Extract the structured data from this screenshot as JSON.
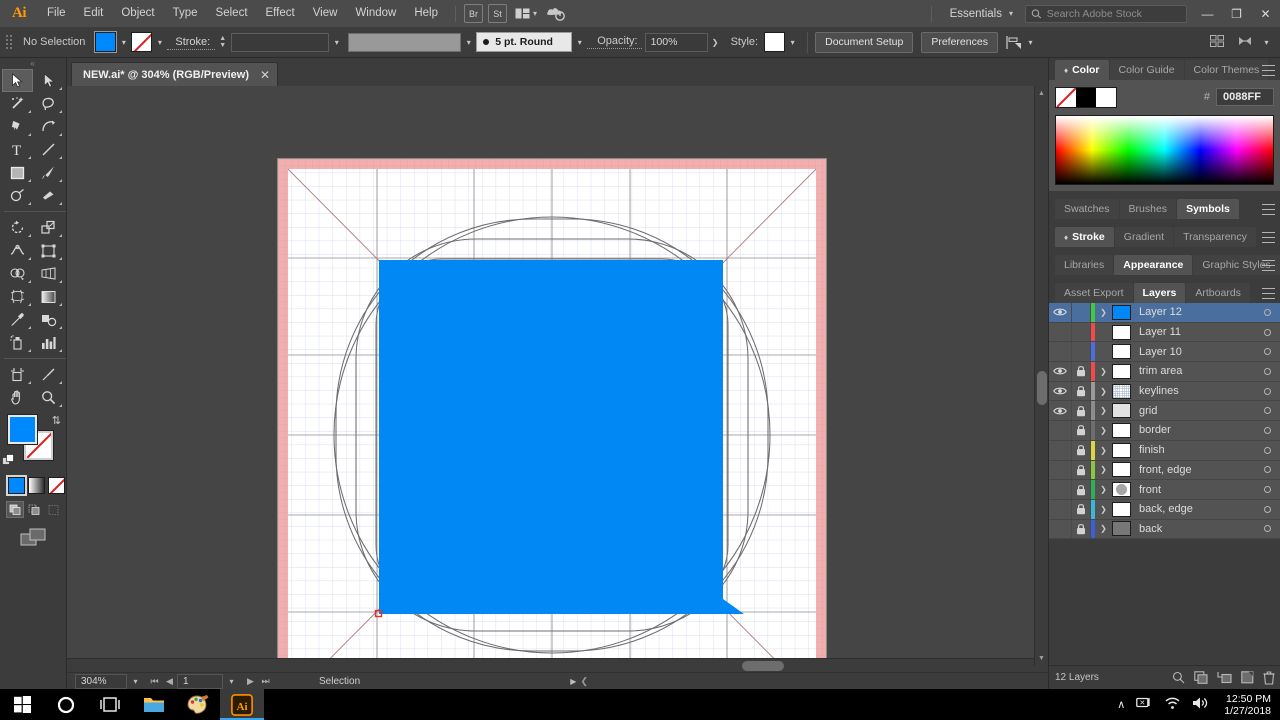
{
  "app": {
    "logo": "Ai",
    "menus": [
      "File",
      "Edit",
      "Object",
      "Type",
      "Select",
      "Effect",
      "View",
      "Window",
      "Help"
    ],
    "bridge_label": "Br",
    "stock_label": "St",
    "workspace": "Essentials",
    "search_placeholder": "Search Adobe Stock",
    "search_value": "",
    "window_minimize": "—",
    "window_restore": "❐",
    "window_close": "✕"
  },
  "control_bar": {
    "selection_status": "No Selection",
    "fill_color": "#0088FF",
    "stroke_color": "none",
    "stroke_label": "Stroke:",
    "stroke_weight": "",
    "variable_width": "",
    "brush_definition": "5 pt. Round",
    "opacity_label": "Opacity:",
    "opacity_value": "100%",
    "style_label": "Style:",
    "document_setup": "Document Setup",
    "preferences": "Preferences"
  },
  "document": {
    "tab_title": "NEW.ai* @ 304% (RGB/Preview)",
    "tab_close": "✕"
  },
  "status_bar": {
    "zoom": "304%",
    "page": "1",
    "status_text": "Selection"
  },
  "tools": [
    {
      "name": "selection-tool",
      "active": true
    },
    {
      "name": "direct-selection-tool",
      "active": false
    },
    {
      "name": "magic-wand-tool",
      "active": false
    },
    {
      "name": "lasso-tool",
      "active": false
    },
    {
      "name": "pen-tool",
      "active": false
    },
    {
      "name": "curvature-tool",
      "active": false
    },
    {
      "name": "type-tool",
      "active": false
    },
    {
      "name": "line-segment-tool",
      "active": false
    },
    {
      "name": "rectangle-tool",
      "active": false
    },
    {
      "name": "paintbrush-tool",
      "active": false
    },
    {
      "name": "shaper-tool",
      "active": false
    },
    {
      "name": "eraser-tool",
      "active": false
    },
    {
      "name": "rotate-tool",
      "active": false
    },
    {
      "name": "scale-tool",
      "active": false
    },
    {
      "name": "width-tool",
      "active": false
    },
    {
      "name": "free-transform-tool",
      "active": false
    },
    {
      "name": "shape-builder-tool",
      "active": false
    },
    {
      "name": "perspective-grid-tool",
      "active": false
    },
    {
      "name": "mesh-tool",
      "active": false
    },
    {
      "name": "gradient-tool",
      "active": false
    },
    {
      "name": "eyedropper-tool",
      "active": false
    },
    {
      "name": "blend-tool",
      "active": false
    },
    {
      "name": "symbol-sprayer-tool",
      "active": false
    },
    {
      "name": "column-graph-tool",
      "active": false
    },
    {
      "name": "artboard-tool",
      "active": false
    },
    {
      "name": "slice-tool",
      "active": false
    },
    {
      "name": "hand-tool",
      "active": false
    },
    {
      "name": "zoom-tool",
      "active": false
    }
  ],
  "color_panel": {
    "tabs": [
      {
        "label": "Color",
        "active": true
      },
      {
        "label": "Color Guide",
        "active": false
      },
      {
        "label": "Color Themes",
        "active": false
      }
    ],
    "hex_prefix": "#",
    "hex_value": "0088FF"
  },
  "panel_groups": [
    {
      "name": "swatches-group",
      "tabs": [
        {
          "label": "Swatches",
          "active": false
        },
        {
          "label": "Brushes",
          "active": false
        },
        {
          "label": "Symbols",
          "active": true
        }
      ]
    },
    {
      "name": "stroke-group",
      "tabs": [
        {
          "label": "Stroke",
          "active": true
        },
        {
          "label": "Gradient",
          "active": false
        },
        {
          "label": "Transparency",
          "active": false
        }
      ]
    },
    {
      "name": "libraries-group",
      "tabs": [
        {
          "label": "Libraries",
          "active": false
        },
        {
          "label": "Appearance",
          "active": true
        },
        {
          "label": "Graphic Styles",
          "active": false
        }
      ]
    },
    {
      "name": "layers-group",
      "tabs": [
        {
          "label": "Asset Export",
          "active": false
        },
        {
          "label": "Layers",
          "active": true
        },
        {
          "label": "Artboards",
          "active": false
        }
      ]
    }
  ],
  "layers": {
    "footer_count": "12 Layers",
    "rows": [
      {
        "name": "Layer 12",
        "visible": true,
        "locked": false,
        "selected": true,
        "color": "#3ecb3e",
        "expandable": true,
        "thumb": "blue"
      },
      {
        "name": "Layer 11",
        "visible": false,
        "locked": false,
        "selected": false,
        "color": "#f04a4a",
        "expandable": false,
        "thumb": "white"
      },
      {
        "name": "Layer 10",
        "visible": false,
        "locked": false,
        "selected": false,
        "color": "#4a6fe0",
        "expandable": false,
        "thumb": "white"
      },
      {
        "name": "trim area",
        "visible": true,
        "locked": true,
        "selected": false,
        "color": "#f04a4a",
        "expandable": true,
        "thumb": "white"
      },
      {
        "name": "keylines",
        "visible": true,
        "locked": true,
        "selected": false,
        "color": "#9a9a9a",
        "expandable": true,
        "thumb": "grid"
      },
      {
        "name": "grid",
        "visible": true,
        "locked": true,
        "selected": false,
        "color": "#8d8d8d",
        "expandable": true,
        "thumb": "lightgray"
      },
      {
        "name": "border",
        "visible": false,
        "locked": true,
        "selected": false,
        "color": "#6e6e6e",
        "expandable": true,
        "thumb": "white"
      },
      {
        "name": "finish",
        "visible": false,
        "locked": true,
        "selected": false,
        "color": "#d7d742",
        "expandable": true,
        "thumb": "white"
      },
      {
        "name": "front, edge",
        "visible": false,
        "locked": true,
        "selected": false,
        "color": "#8cc63f",
        "expandable": true,
        "thumb": "white"
      },
      {
        "name": "front",
        "visible": false,
        "locked": true,
        "selected": false,
        "color": "#2fae5a",
        "expandable": true,
        "thumb": "circle"
      },
      {
        "name": "back, edge",
        "visible": false,
        "locked": true,
        "selected": false,
        "color": "#3ab6d6",
        "expandable": true,
        "thumb": "white"
      },
      {
        "name": "back",
        "visible": false,
        "locked": true,
        "selected": false,
        "color": "#3a5fd6",
        "expandable": true,
        "thumb": "gray"
      }
    ]
  },
  "artwork": {
    "shape_fill": "#0288f4",
    "bleed_color": "#f2aeae",
    "guide_color": "#6a6a6a",
    "grid_color": "#cfd6e8",
    "description": "Rounded-square icon construction grid with blue shape"
  },
  "taskbar": {
    "items": [
      {
        "name": "start-button"
      },
      {
        "name": "cortana-button"
      },
      {
        "name": "task-view-button"
      },
      {
        "name": "file-explorer-button"
      },
      {
        "name": "paint-button"
      },
      {
        "name": "illustrator-button"
      }
    ],
    "tray": {
      "show_hidden": "∧",
      "network_icon": "network-icon",
      "wifi_icon": "wifi-icon",
      "volume_icon": "volume-icon"
    },
    "time": "12:50 PM",
    "date": "1/27/2018"
  }
}
